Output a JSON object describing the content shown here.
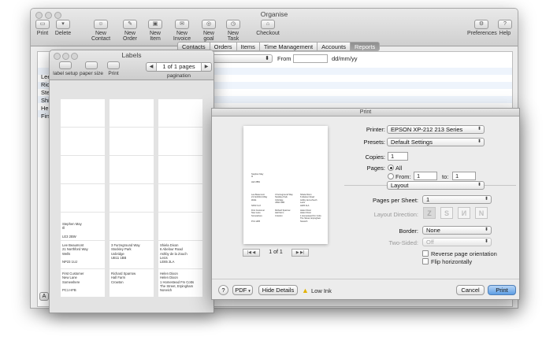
{
  "main_window": {
    "title": "Organise",
    "toolbar": [
      {
        "id": "print",
        "label": "Print",
        "icon": "printer-icon"
      },
      {
        "id": "delete",
        "label": "Delete",
        "icon": "trash-icon"
      },
      {
        "id": "new-contact",
        "label": "New Contact",
        "icon": "contact-icon"
      },
      {
        "id": "new-order",
        "label": "New Order",
        "icon": "order-icon"
      },
      {
        "id": "new-item",
        "label": "New Item",
        "icon": "box-icon"
      },
      {
        "id": "new-invoice",
        "label": "New Invoice",
        "icon": "envelope-icon"
      },
      {
        "id": "new-goal",
        "label": "New goal",
        "icon": "target-icon"
      },
      {
        "id": "new-task",
        "label": "New Task",
        "icon": "clock-icon"
      },
      {
        "id": "checkout",
        "label": "Checkout",
        "icon": "cart-icon"
      },
      {
        "id": "preferences",
        "label": "Preferences",
        "icon": "gear-icon"
      },
      {
        "id": "help",
        "label": "Help",
        "icon": "help-icon"
      }
    ],
    "tabs": [
      "Contacts",
      "Orders",
      "Items",
      "Time Management",
      "Accounts",
      "Reports"
    ],
    "active_tab": "Reports",
    "from_label": "From",
    "date_format": "dd/mm/yy",
    "list_items": [
      "Lee",
      "Rich",
      "Step",
      "Shi",
      "Hele",
      "Firs"
    ],
    "bottom_button": "A"
  },
  "labels_window": {
    "title": "Labels",
    "tools": [
      {
        "label": "label setup",
        "icon": "label-setup-icon"
      },
      {
        "label": "paper size",
        "icon": "page-icon"
      },
      {
        "label": "Print",
        "icon": "printer-icon"
      }
    ],
    "pager_text": "1 of 1 pages",
    "pagination_label": "pagination",
    "cells": [
      {
        "row": 4,
        "col": 0,
        "text": "Stephen May\nIll\n\nLE3 2BW"
      },
      {
        "row": 5,
        "col": 0,
        "text": "Lee Beaumont\n21 Northford Way\nWells\n\nNP23 1UJ"
      },
      {
        "row": 5,
        "col": 1,
        "text": "3 Furzeground Way\nStockley Park\nUxbridge\nUB11 1BB"
      },
      {
        "row": 5,
        "col": 2,
        "text": "Shiela Dixon\n6 Abelour Road\nAshby de la Zouch\nLeics\nLE65 2LA"
      },
      {
        "row": 6,
        "col": 0,
        "text": "First Customer\nNew Lane\nSomewhere\n\nPC1 HFB"
      },
      {
        "row": 6,
        "col": 1,
        "text": "Richard Sparrow\nHall Farm\nCrowton"
      },
      {
        "row": 6,
        "col": 2,
        "text": "Helen Dixon\nHelen Dixon\n1 Homestead Fm Cotts\nThe Street, Erpingham\nNorwich"
      }
    ]
  },
  "print_dialog": {
    "title": "Print",
    "printer_label": "Printer:",
    "printer_value": "EPSON XP-212 213 Series",
    "presets_label": "Presets:",
    "presets_value": "Default Settings",
    "copies_label": "Copies:",
    "copies_value": "1",
    "pages_label": "Pages:",
    "pages_all": "All",
    "pages_from": "From:",
    "pages_from_value": "1",
    "pages_to": "to:",
    "pages_to_value": "1",
    "section_select": "Layout",
    "pages_per_sheet_label": "Pages per Sheet:",
    "pages_per_sheet_value": "1",
    "layout_direction_label": "Layout Direction:",
    "border_label": "Border:",
    "border_value": "None",
    "two_sided_label": "Two-Sided:",
    "two_sided_value": "Off",
    "reverse_label": "Reverse page orientation",
    "flip_label": "Flip horizontally",
    "preview_nav_text": "1 of 1",
    "help_button": "?",
    "pdf_button": "PDF",
    "hide_details_button": "Hide Details",
    "low_ink_label": "Low Ink",
    "cancel_button": "Cancel",
    "print_button": "Print",
    "preview_blocks": [
      "Stephen May\nIll\n\nLE3 2BW",
      "Lee Beaumont\n21 Northford Way\nWells\n\nNP23 1UJ",
      "3 Furzeground Way\nStockley Park\nUxbridge\nUB11 1BB",
      "Shiela Dixon\n6 Abelour Road\nAshby de la Zouch\nLeics\nLE65 2LA",
      "First Customer\nNew Lane\nSomewhere\n\nPC1 HFB",
      "Richard Sparrow\nHall Farm\nCrowton",
      "Helen Dixon\nHelen Dixon\n1 Homestead Fm Cotts\nThe Street, Erpingham\nNorwich"
    ]
  }
}
